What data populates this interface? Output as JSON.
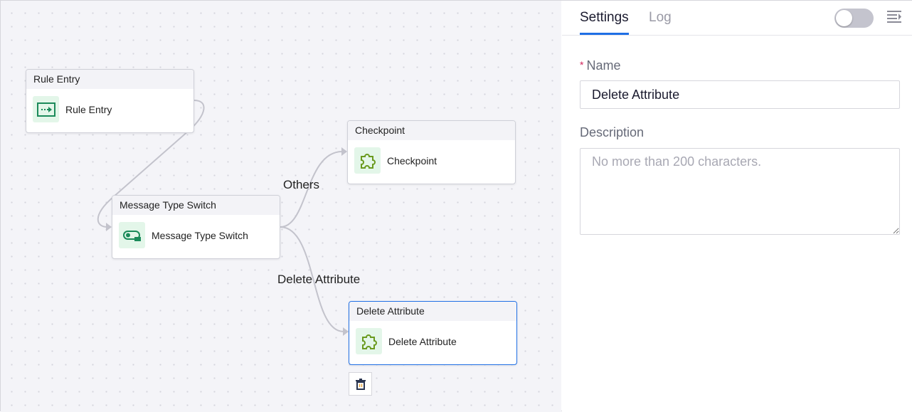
{
  "canvas": {
    "nodes": [
      {
        "header": "Rule Entry",
        "label": "Rule Entry",
        "icon": "rule-entry-icon"
      },
      {
        "header": "Checkpoint",
        "label": "Checkpoint",
        "icon": "puzzle-icon"
      },
      {
        "header": "Message Type Switch",
        "label": "Message Type Switch",
        "icon": "switch-icon"
      },
      {
        "header": "Delete Attribute",
        "label": "Delete Attribute",
        "icon": "puzzle-icon",
        "selected": true
      }
    ],
    "edge_labels": {
      "others": "Others",
      "delete_attribute": "Delete Attribute"
    }
  },
  "panel": {
    "tabs": [
      {
        "label": "Settings",
        "active": true
      },
      {
        "label": "Log"
      }
    ],
    "toggle_on": false,
    "name_label": "Name",
    "required_mark": "*",
    "name_value": "Delete Attribute",
    "description_label": "Description",
    "description_placeholder": "No more than 200 characters."
  },
  "colors": {
    "accent": "#1f6fe5",
    "icon_green": "#1b8a5a",
    "puzzle_green": "#6a9a1f"
  }
}
